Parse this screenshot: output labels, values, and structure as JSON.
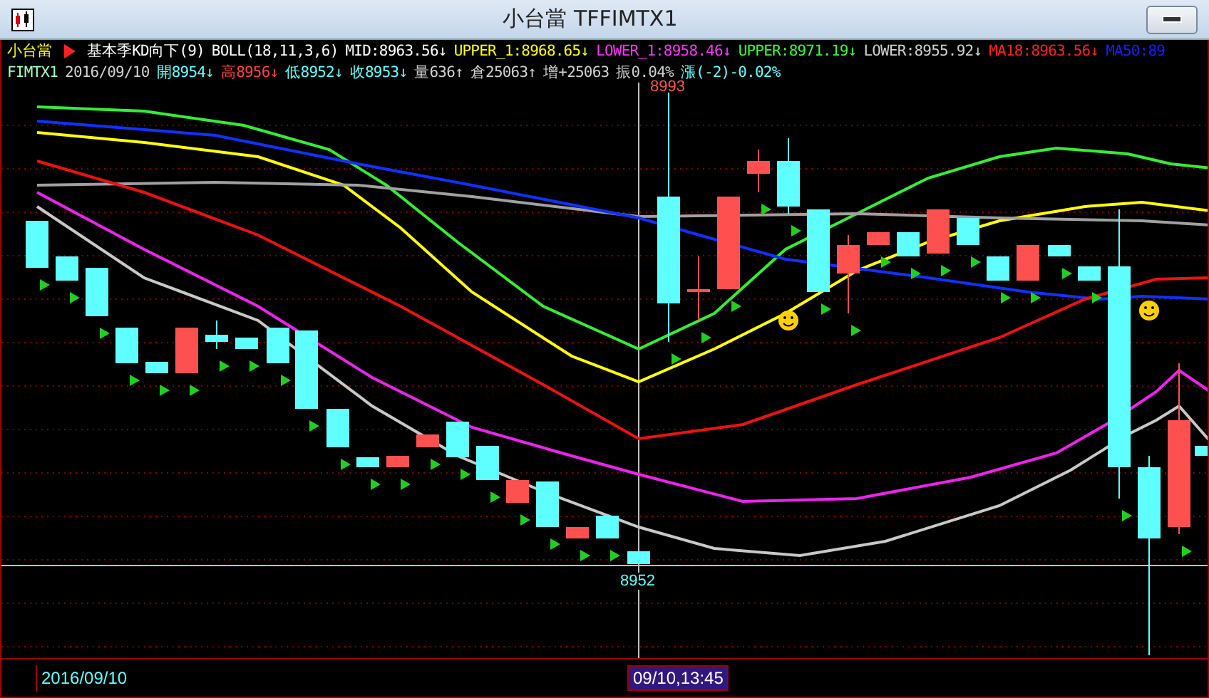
{
  "window": {
    "title": "小台當 TFFIMTX1"
  },
  "header": {
    "line_1": [
      {
        "text": "小台當",
        "color": "#ffff00"
      },
      {
        "text": "基本季KD向下(9)",
        "color": "#ffffff"
      },
      {
        "text": "BOLL(18,11,3,6)",
        "color": "#ffffff"
      },
      {
        "text": "MID:8963.56↓",
        "color": "#ffffff"
      },
      {
        "text": "UPPER_1:8968.65↓",
        "color": "#ffff00"
      },
      {
        "text": "LOWER_1:8958.46↓",
        "color": "#ff33ff"
      },
      {
        "text": "UPPER:8971.19↓",
        "color": "#33ff33"
      },
      {
        "text": "LOWER:8955.92↓",
        "color": "#d0d0d0"
      },
      {
        "text": "MA18:8963.56↓",
        "color": "#ff2020"
      },
      {
        "text": "MA50:89",
        "color": "#1020ff"
      }
    ],
    "line_2": [
      {
        "text": "FIMTX1",
        "color": "#a0ffc0"
      },
      {
        "text": "2016/09/10",
        "color": "#d0d0d0"
      },
      {
        "text": "開8954↓",
        "color": "#60ffff"
      },
      {
        "text": "高8956↓",
        "color": "#ff4040"
      },
      {
        "text": "低8952↓",
        "color": "#60ffff"
      },
      {
        "text": "收8953↓",
        "color": "#60ffff"
      },
      {
        "text": "量636↑",
        "color": "#d0d0d0"
      },
      {
        "text": "倉25063↑",
        "color": "#d0d0d0"
      },
      {
        "text": "增+25063",
        "color": "#d0d0d0"
      },
      {
        "text": "振0.04%",
        "color": "#d0d0d0"
      },
      {
        "text": "漲(-2)-0.02%",
        "color": "#60ffff"
      }
    ]
  },
  "chart": {
    "high_label": "8993",
    "crosshair_price": "8952"
  },
  "footer": {
    "date": "2016/09/10",
    "crosshair_time": "09/10,13:45"
  }
}
